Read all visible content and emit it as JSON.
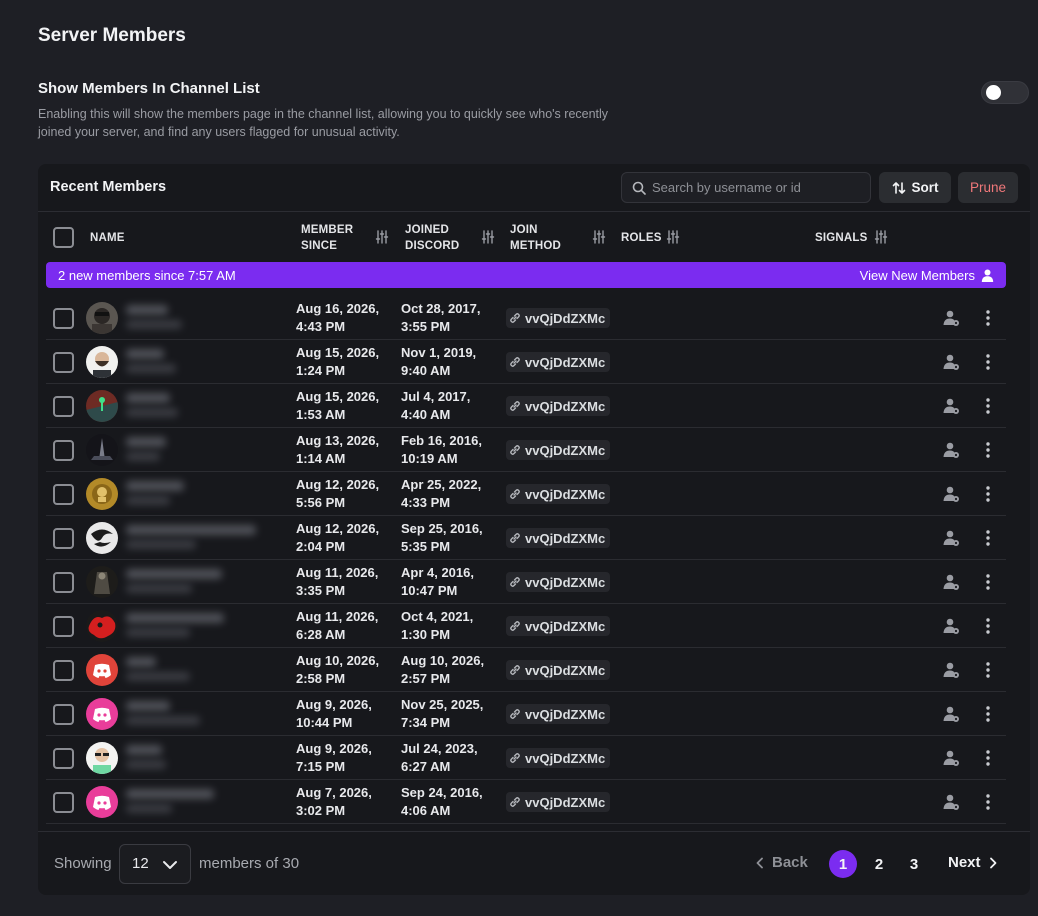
{
  "page": {
    "title": "Server Members"
  },
  "setting": {
    "title": "Show Members In Channel List",
    "description": "Enabling this will show the members page in the channel list, allowing you to quickly see who's recently joined your server, and find any users flagged for unusual activity.",
    "enabled": false
  },
  "panel": {
    "title": "Recent Members",
    "search_placeholder": "Search by username or id",
    "sort_label": "Sort",
    "prune_label": "Prune"
  },
  "columns": {
    "name": "NAME",
    "member_since": "MEMBER SINCE",
    "joined_discord": "JOINED DISCORD",
    "join_method": "JOIN METHOD",
    "roles": "ROLES",
    "signals": "SIGNALS"
  },
  "banner": {
    "text": "2 new members since 7:57 AM",
    "link": "View New Members"
  },
  "members": [
    {
      "avatar": "dark-character",
      "member_since": [
        "Aug 16, 2026,",
        "4:43 PM"
      ],
      "joined": [
        "Oct 28, 2017,",
        "3:55 PM"
      ],
      "invite": "vvQjDdZXMc"
    },
    {
      "avatar": "bearded-face",
      "member_since": [
        "Aug 15, 2026,",
        "1:24 PM"
      ],
      "joined": [
        "Nov 1, 2019,",
        "9:40 AM"
      ],
      "invite": "vvQjDdZXMc"
    },
    {
      "avatar": "green-figure",
      "member_since": [
        "Aug 15, 2026,",
        "1:53 AM"
      ],
      "joined": [
        "Jul 4, 2017,",
        "4:40 AM"
      ],
      "invite": "vvQjDdZXMc"
    },
    {
      "avatar": "dark-spire",
      "member_since": [
        "Aug 13, 2026,",
        "1:14 AM"
      ],
      "joined": [
        "Feb 16, 2016,",
        "10:19 AM"
      ],
      "invite": "vvQjDdZXMc"
    },
    {
      "avatar": "gold-emblem",
      "member_since": [
        "Aug 12, 2026,",
        "5:56 PM"
      ],
      "joined": [
        "Apr 25, 2022,",
        "4:33 PM"
      ],
      "invite": "vvQjDdZXMc"
    },
    {
      "avatar": "white-swirl",
      "member_since": [
        "Aug 12, 2026,",
        "2:04 PM"
      ],
      "joined": [
        "Sep 25, 2016,",
        "5:35 PM"
      ],
      "invite": "vvQjDdZXMc"
    },
    {
      "avatar": "dark-figure",
      "member_since": [
        "Aug 11, 2026,",
        "3:35 PM"
      ],
      "joined": [
        "Apr 4, 2016,",
        "10:47 PM"
      ],
      "invite": "vvQjDdZXMc"
    },
    {
      "avatar": "red-splash",
      "member_since": [
        "Aug 11, 2026,",
        "6:28 AM"
      ],
      "joined": [
        "Oct 4, 2021,",
        "1:30 PM"
      ],
      "invite": "vvQjDdZXMc"
    },
    {
      "avatar": "discord-red",
      "member_since": [
        "Aug 10, 2026,",
        "2:58 PM"
      ],
      "joined": [
        "Aug 10, 2026,",
        "2:57 PM"
      ],
      "invite": "vvQjDdZXMc"
    },
    {
      "avatar": "discord-pink",
      "member_since": [
        "Aug 9, 2026,",
        "10:44 PM"
      ],
      "joined": [
        "Nov 25, 2025,",
        "7:34 PM"
      ],
      "invite": "vvQjDdZXMc"
    },
    {
      "avatar": "sunglasses-face",
      "member_since": [
        "Aug 9, 2026,",
        "7:15 PM"
      ],
      "joined": [
        "Jul 24, 2023,",
        "6:27 AM"
      ],
      "invite": "vvQjDdZXMc"
    },
    {
      "avatar": "discord-pink",
      "member_since": [
        "Aug 7, 2026,",
        "3:02 PM"
      ],
      "joined": [
        "Sep 24, 2016,",
        "4:06 AM"
      ],
      "invite": "vvQjDdZXMc"
    }
  ],
  "footer": {
    "showing_label": "Showing",
    "page_size": "12",
    "members_of": "members of 30",
    "back_label": "Back",
    "pages": [
      "1",
      "2",
      "3"
    ],
    "current_page": "1",
    "next_label": "Next"
  },
  "colors": {
    "accent": "#7b2cf0",
    "prune": "#f0787a",
    "background": "#1e1f25",
    "panel": "#17181c"
  }
}
